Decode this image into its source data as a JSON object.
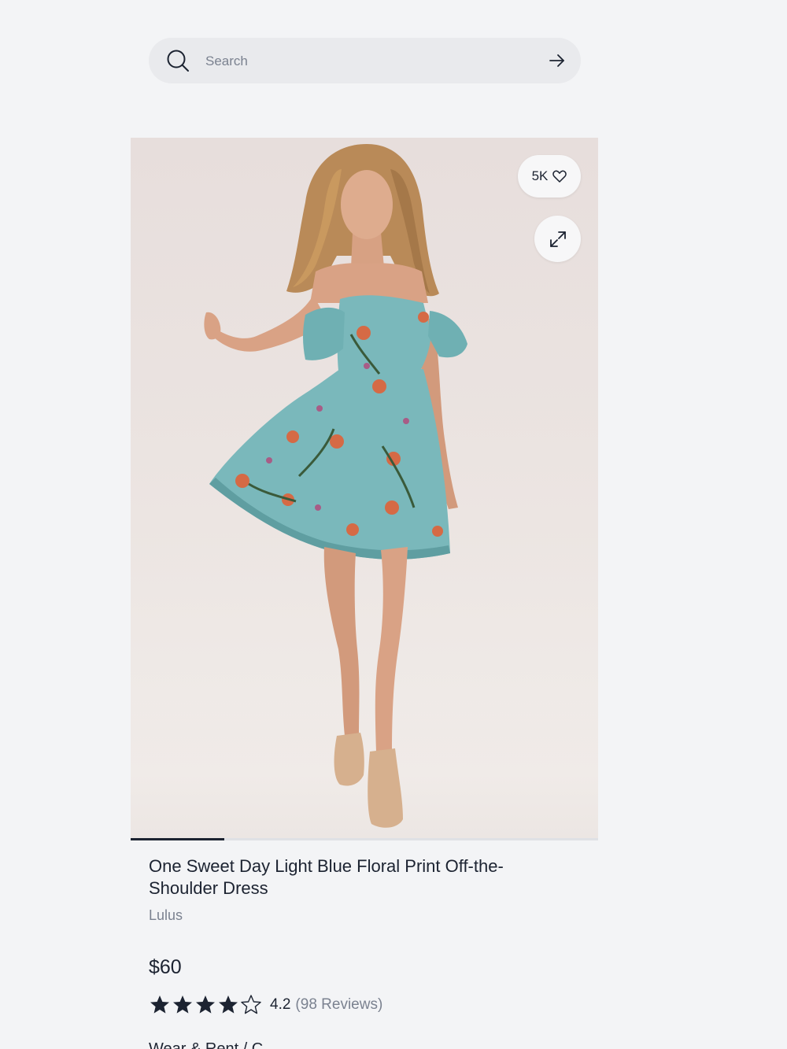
{
  "search": {
    "placeholder": "Search",
    "value": ""
  },
  "product": {
    "likes": "5K",
    "image_index": 1,
    "image_count": 5,
    "title": "One Sweet Day Light Blue Floral Print Off-the-Shoulder Dress",
    "brand": "Lulus",
    "price": "$60",
    "rating": 4.2,
    "rating_text": "4.2",
    "reviews_text": "(98 Reviews)",
    "next_section_heading": "Wear & Rent / C..."
  },
  "icons": {
    "search": "search-icon",
    "submit": "arrow-right-icon",
    "like": "heart-icon",
    "expand": "expand-icon",
    "star_full": "star-filled-icon",
    "star_empty": "star-outline-icon"
  },
  "colors": {
    "background": "#f3f4f6",
    "text": "#1c2331",
    "muted": "#7b8290",
    "dress": "#7ab8bb"
  }
}
